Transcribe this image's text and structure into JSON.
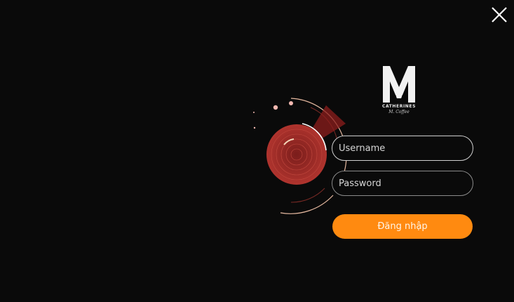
{
  "window": {
    "close_icon": "close-icon"
  },
  "logo": {
    "letter": "M",
    "brand": "CATHERINES",
    "tagline": "M. Coffee"
  },
  "form": {
    "username_placeholder": "Username",
    "password_placeholder": "Password",
    "login_label": "Đăng nhập"
  },
  "colors": {
    "background": "#0a0a0a",
    "accent": "#ff8a10",
    "radar": "#9e2b27"
  }
}
